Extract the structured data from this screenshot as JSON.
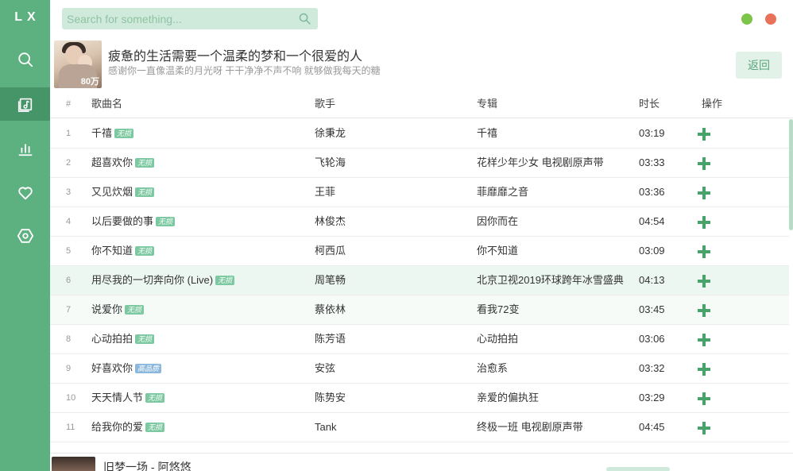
{
  "app": {
    "logo": "LX"
  },
  "sidebar": {
    "items": [
      {
        "id": "search",
        "icon": "search-icon"
      },
      {
        "id": "songlist",
        "icon": "music-note-icon",
        "active": true
      },
      {
        "id": "leaderboard",
        "icon": "bar-chart-icon"
      },
      {
        "id": "favorites",
        "icon": "heart-icon"
      },
      {
        "id": "settings",
        "icon": "hexagon-settings-icon"
      }
    ]
  },
  "search": {
    "placeholder": "Search for something..."
  },
  "window_controls": {
    "minimize_color": "#7cc54a",
    "close_color": "#e9715a"
  },
  "playlist": {
    "title": "疲惫的生活需要一个温柔的梦和一个很爱的人",
    "description": "感谢你一直像温柔的月光呀 干干净净不声不响 就够做我每天的糖",
    "play_count": "80万",
    "back_label": "返回"
  },
  "table": {
    "headers": {
      "num": "#",
      "name": "歌曲名",
      "singer": "歌手",
      "album": "专辑",
      "duration": "时长",
      "action": "操作"
    },
    "rows": [
      {
        "num": "1",
        "name": "千禧",
        "badge": "无损",
        "singer": "徐秉龙",
        "album": "千禧",
        "duration": "03:19"
      },
      {
        "num": "2",
        "name": "超喜欢你",
        "badge": "无损",
        "singer": "飞轮海",
        "album": "花样少年少女 电视剧原声带",
        "duration": "03:33"
      },
      {
        "num": "3",
        "name": "又见炊烟",
        "badge": "无损",
        "singer": "王菲",
        "album": "菲靡靡之音",
        "duration": "03:36"
      },
      {
        "num": "4",
        "name": "以后要做的事",
        "badge": "无损",
        "singer": "林俊杰",
        "album": "因你而在",
        "duration": "04:54"
      },
      {
        "num": "5",
        "name": "你不知道",
        "badge": "无损",
        "singer": "柯西瓜",
        "album": "你不知道",
        "duration": "03:09"
      },
      {
        "num": "6",
        "name": "用尽我的一切奔向你 (Live)",
        "badge": "无损",
        "singer": "周笔畅",
        "album": "北京卫视2019环球跨年冰雪盛典",
        "duration": "04:13"
      },
      {
        "num": "7",
        "name": "说爱你",
        "badge": "无损",
        "singer": "蔡依林",
        "album": "看我72变",
        "duration": "03:45"
      },
      {
        "num": "8",
        "name": "心动拍拍",
        "badge": "无损",
        "singer": "陈芳语",
        "album": "心动拍拍",
        "duration": "03:06"
      },
      {
        "num": "9",
        "name": "好喜欢你",
        "badge": "高品质",
        "singer": "安弦",
        "album": "治愈系",
        "duration": "03:32"
      },
      {
        "num": "10",
        "name": "天天情人节",
        "badge": "无损",
        "singer": "陈势安",
        "album": "亲爱的偏执狂",
        "duration": "03:29"
      },
      {
        "num": "11",
        "name": "给我你的爱",
        "badge": "无损",
        "singer": "Tank",
        "album": "终极一班 电视剧原声带",
        "duration": "04:45"
      }
    ]
  },
  "player": {
    "now_playing": "旧梦一场 - 阿悠悠"
  },
  "colors": {
    "accent": "#5db080",
    "sidebar_active": "#469569",
    "add_icon": "#47a36a"
  }
}
